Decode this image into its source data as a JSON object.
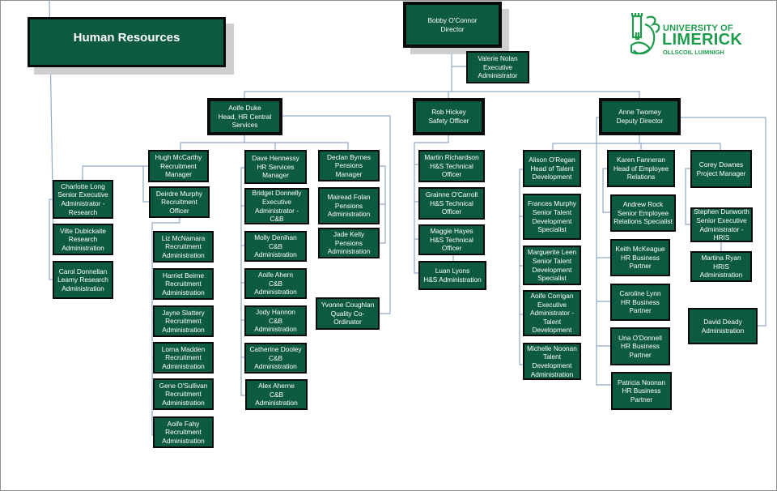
{
  "page": {
    "title": "Human Resources",
    "logo": {
      "line1": "UNIVERSITY OF",
      "line2": "LIMERICK",
      "line3": "OLLSCOIL LUIMNIGH",
      "icon": "castle-stag-crest-icon",
      "color": "#1f9b4d"
    },
    "colors": {
      "box_fill": "#0d5a42",
      "box_border": "#0b0b0b",
      "connector": "#8fa8c4",
      "shadow": "#cfcfcf"
    }
  },
  "people": {
    "director": {
      "name": "Bobby O'Connor",
      "role": "Director"
    },
    "exec_admin": {
      "name": "Valerie Nolan",
      "role": "Executive\nAdministrator"
    },
    "aoife_duke": {
      "name": "Aoife Duke",
      "role": "Head, HR Central\nServices"
    },
    "rob_hickey": {
      "name": "Rob Hickey",
      "role": "Safety Officer"
    },
    "anne_twomey": {
      "name": "Anne Twomey",
      "role": "Deputy Director"
    },
    "hugh_mccarthy": {
      "name": "Hugh McCarthy",
      "role": "Recruitment\nManager"
    },
    "charlotte_long": {
      "name": "Charlotte Long",
      "role": "Senior Executive\nAdministrator -\nResearch"
    },
    "vilte_dubickaite": {
      "name": "Vilte Dubickaite",
      "role": "Research\nAdministration"
    },
    "carol_donnellan": {
      "name": "Carol Donnellan",
      "role": "Leamy Research\nAdministration"
    },
    "deirdre_murphy": {
      "name": "Deirdre Murphy",
      "role": "Recruitment\nOfficer"
    },
    "liz_mcnamara": {
      "name": "Liz McNamara",
      "role": "Recruitment\nAdministration"
    },
    "harriet_beirne": {
      "name": "Harriet Beirne",
      "role": "Recruitment\nAdministration"
    },
    "jayne_slattery": {
      "name": "Jayne Slattery",
      "role": "Recruitment\nAdministration"
    },
    "lorna_madden": {
      "name": "Lorna Madden",
      "role": "Recruitment\nAdministration"
    },
    "gene_osullivan": {
      "name": "Gene O'Sullivan",
      "role": "Recruitment\nAdministration"
    },
    "aoife_fahy": {
      "name": "Aoife Fahy",
      "role": "Recruitment\nAdministration"
    },
    "dave_hennessy": {
      "name": "Dave Hennessy",
      "role": "HR Services\nManager"
    },
    "bridget_donnelly": {
      "name": "Bridget Donnelly",
      "role": "Executive\nAdministrator - C&B"
    },
    "molly_denihan": {
      "name": "Molly Denihan",
      "role": "C&B\nAdministration"
    },
    "aoife_ahern": {
      "name": "Aoife Ahern",
      "role": "C&B\nAdministration"
    },
    "jody_hannon": {
      "name": "Jody Hannon",
      "role": "C&B\nAdministration"
    },
    "catherine_dooley": {
      "name": "Catherine Dooley",
      "role": "C&B\nAdministration"
    },
    "alex_aherne": {
      "name": "Alex Aherne",
      "role": "C&B\nAdministration"
    },
    "declan_byrnes": {
      "name": "Declan Byrnes",
      "role": "Pensions Manager"
    },
    "mairead_folan": {
      "name": "Mairead Folan",
      "role": "Pensions\nAdministration"
    },
    "jade_kelly": {
      "name": "Jade Kelly",
      "role": "Pensions\nAdministration"
    },
    "yvonne_coughlan": {
      "name": "Yvonne Coughlan",
      "role": "Quality Co-\nOrdinator"
    },
    "martin_richardson": {
      "name": "Martin Richardson",
      "role": "H&S Technical\nOfficer"
    },
    "grainne_ocarroll": {
      "name": "Grainne O'Carroll",
      "role": "H&S Technical\nOfficer"
    },
    "maggie_hayes": {
      "name": "Maggie Hayes",
      "role": "H&S Technical\nOfficer"
    },
    "luan_lyons": {
      "name": "Luan Lyons",
      "role": "H&S Administration"
    },
    "alison_oregan": {
      "name": "Alison O'Regan",
      "role": "Head of Talent\nDevelopment"
    },
    "frances_murphy": {
      "name": "Frances Murphy",
      "role": "Senior Talent\nDevelopment\nSpecialist"
    },
    "marguerite_leen": {
      "name": "Marguerite Leen",
      "role": "Senior Talent\nDevelopment\nSpecialist"
    },
    "aoife_corrigan": {
      "name": "Aoife Corrigan",
      "role": "Executive\nAdministrator -\nTalent\nDevelopment"
    },
    "michelle_noonan": {
      "name": "Michelle Noonan",
      "role": "Talent\nDevelopment\nAdministration"
    },
    "karen_fanneran": {
      "name": "Karen Fanneran",
      "role": "Head of Employee\nRelations"
    },
    "andrew_rock": {
      "name": "Andrew Rock",
      "role": "Senior Employee\nRelations Specialist"
    },
    "keith_mckeague": {
      "name": "Keith McKeague",
      "role": "HR Business\nPartner"
    },
    "caroline_lynn": {
      "name": "Caroline Lynn",
      "role": "HR Business\nPartner"
    },
    "una_odonnell": {
      "name": "Una O'Donnell",
      "role": "HR Business\nPartner"
    },
    "patricia_noonan": {
      "name": "Patricia Noonan",
      "role": "HR Business\nPartner"
    },
    "corey_downes": {
      "name": "Corey Downes",
      "role": "Project Manager"
    },
    "stephen_dunworth": {
      "name": "Stephen Dunworth",
      "role": "Senior Executive\nAdministrator -\nHRIS"
    },
    "martina_ryan": {
      "name": "Martina Ryan",
      "role": "HRIS\nAdministration"
    },
    "david_deady": {
      "name": "David Deady",
      "role": "Administration"
    }
  }
}
